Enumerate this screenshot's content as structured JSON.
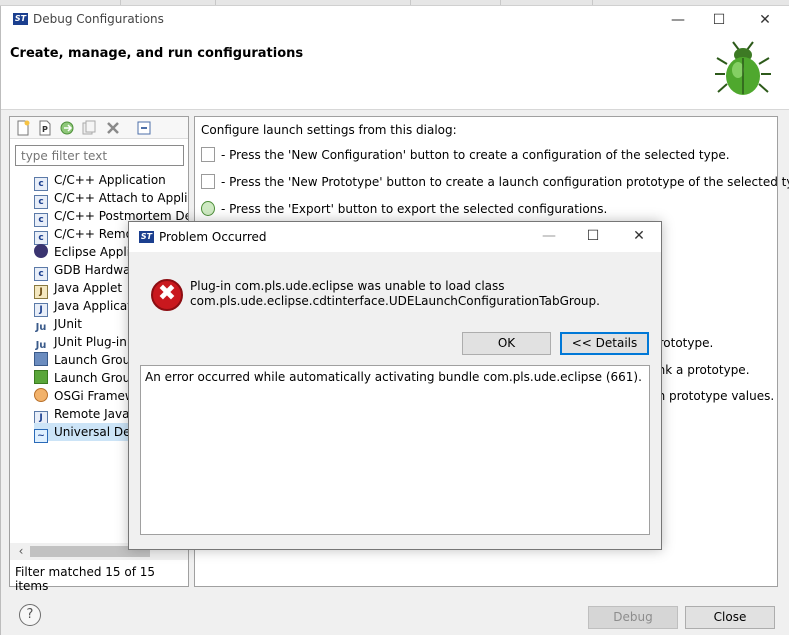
{
  "window": {
    "title": "Debug Configurations",
    "app_icon_text": "ST",
    "minimize": "—",
    "maximize": "☐",
    "close": "✕",
    "banner_title": "Create, manage, and run configurations"
  },
  "left_panel": {
    "toolbar_icons": [
      "new-configuration-icon",
      "new-prototype-icon",
      "export-icon",
      "duplicate-icon",
      "delete-icon",
      "collapse-all-icon"
    ],
    "filter_placeholder": "type filter text",
    "tree_items": [
      {
        "label": "C/C++ Application",
        "icon": "c-icon"
      },
      {
        "label": "C/C++ Attach to Applica",
        "icon": "c-icon"
      },
      {
        "label": "C/C++ Postmortem Deb",
        "icon": "c-icon"
      },
      {
        "label": "C/C++ Remot",
        "icon": "c-icon"
      },
      {
        "label": "Eclipse Applic",
        "icon": "eclipse-icon"
      },
      {
        "label": "GDB Hardware",
        "icon": "c-icon"
      },
      {
        "label": "Java Applet",
        "icon": "java-applet-icon"
      },
      {
        "label": "Java Applicatio",
        "icon": "java-icon"
      },
      {
        "label": "JUnit",
        "icon": "junit-icon"
      },
      {
        "label": "JUnit Plug-in T",
        "icon": "junit-plugin-icon"
      },
      {
        "label": "Launch Group",
        "icon": "launch-group-icon"
      },
      {
        "label": "Launch Group",
        "icon": "launch-group-icon"
      },
      {
        "label": "OSGi Framewo",
        "icon": "osgi-icon"
      },
      {
        "label": "Remote Java A",
        "icon": "remote-java-icon"
      },
      {
        "label": "Universal Debu",
        "icon": "universal-debug-icon"
      }
    ],
    "status": "Filter matched 15 of 15 items"
  },
  "right_panel": {
    "heading": "Configure launch settings from this dialog:",
    "lines": [
      "- Press the 'New Configuration' button to create a configuration of the selected type.",
      "- Press the 'New Prototype' button to create a launch configuration prototype of the selected type.",
      "- Press the 'Export' button to export the selected configurations."
    ],
    "partial_lines": [
      "prototype.",
      "link a prototype.",
      "ch prototype values."
    ]
  },
  "bottom": {
    "help": "?",
    "debug_label": "Debug",
    "close_label": "Close"
  },
  "dialog": {
    "title": "Problem Occurred",
    "icon_text": "ST",
    "minimize": "—",
    "maximize": "☐",
    "close": "✕",
    "message_line1": "Plug-in com.pls.ude.eclipse was unable to load class",
    "message_line2": "com.pls.ude.eclipse.cdtinterface.UDELaunchConfigurationTabGroup.",
    "ok_label": "OK",
    "details_label": "<< Details",
    "details_text": "An error occurred while automatically activating bundle com.pls.ude.eclipse (661).",
    "error_icon": "✖"
  }
}
